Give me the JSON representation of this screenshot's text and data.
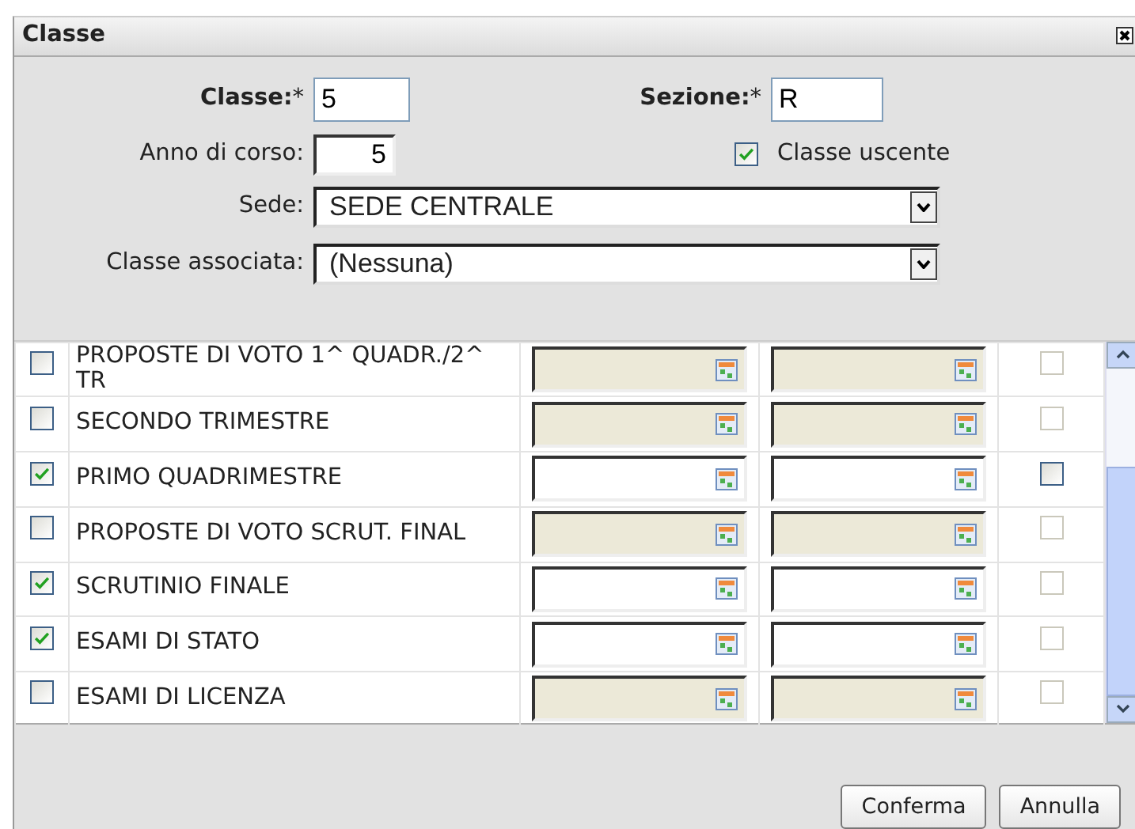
{
  "dialog": {
    "title": "Classe"
  },
  "form": {
    "classe": {
      "label": "Classe:",
      "required_mark": "*",
      "value": "5"
    },
    "sezione": {
      "label": "Sezione:",
      "required_mark": "*",
      "value": "R"
    },
    "anno_di_corso": {
      "label": "Anno di corso:",
      "value": "5"
    },
    "classe_uscente": {
      "label": "Classe uscente",
      "checked": true
    },
    "sede": {
      "label": "Sede:",
      "value": "SEDE CENTRALE"
    },
    "classe_associata": {
      "label": "Classe associata:",
      "value": "(Nessuna)"
    }
  },
  "periods": [
    {
      "name": "PROPOSTE DI VOTO 1^ QUADR./2^ TR",
      "checked": false,
      "flag": {
        "checked": false,
        "disabled": true
      }
    },
    {
      "name": "SECONDO TRIMESTRE",
      "checked": false,
      "flag": {
        "checked": false,
        "disabled": true
      }
    },
    {
      "name": "PRIMO QUADRIMESTRE",
      "checked": true,
      "flag": {
        "checked": false,
        "disabled": false
      }
    },
    {
      "name": "PROPOSTE DI VOTO SCRUT. FINAL",
      "checked": false,
      "flag": {
        "checked": false,
        "disabled": true
      }
    },
    {
      "name": "SCRUTINIO FINALE",
      "checked": true,
      "flag": {
        "checked": false,
        "disabled": true
      }
    },
    {
      "name": "ESAMI DI STATO",
      "checked": true,
      "flag": {
        "checked": false,
        "disabled": true
      }
    },
    {
      "name": "ESAMI DI LICENZA",
      "checked": false,
      "flag": {
        "checked": false,
        "disabled": true
      }
    }
  ],
  "buttons": [
    "Conferma",
    "Annulla"
  ]
}
